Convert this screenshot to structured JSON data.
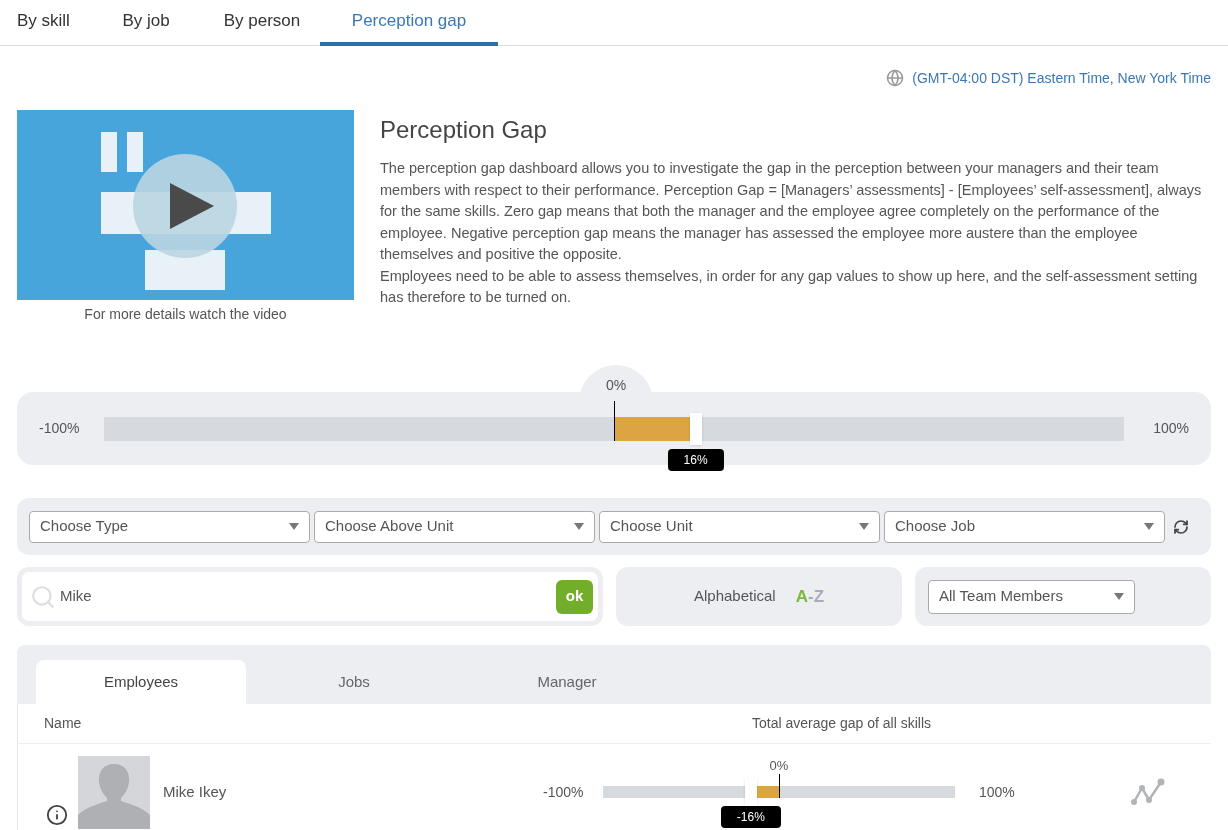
{
  "tabs": [
    {
      "label": "By skill",
      "selected": false
    },
    {
      "label": "By job",
      "selected": false
    },
    {
      "label": "By person",
      "selected": false
    },
    {
      "label": "Perception gap",
      "selected": true
    }
  ],
  "timezone": "(GMT-04:00 DST) Eastern Time, New York Time",
  "video": {
    "caption": "For more details watch the video"
  },
  "intro": {
    "title": "Perception Gap",
    "paragraphs": [
      "The perception gap dashboard allows you to investigate the gap in the perception between your managers and their team members with respect to their performance. Perception Gap = [Managers’ assessments] - [Employees’ self-assessment], always for the same skills. Zero gap means that both the manager and the employee agree completely on the performance of the employee. Negative perception gap means the manager has assessed the employee more austere than the employee themselves and positive the opposite.",
      "Employees need to be able to assess themselves, in order for any gap values to show up here, and the self-assessment setting has therefore to be turned on."
    ]
  },
  "gap_filter": {
    "min_label": "-100%",
    "max_label": "100%",
    "center_label": "0%",
    "level": 0.58,
    "reading": "16%"
  },
  "dropdowns": [
    {
      "placeholder": "Choose Type"
    },
    {
      "placeholder": "Choose Above Unit"
    },
    {
      "placeholder": "Choose Unit"
    },
    {
      "placeholder": "Choose Job"
    }
  ],
  "search": {
    "value": "Mike",
    "button": "ok"
  },
  "sort": {
    "label": "Alphabetical",
    "first": "A",
    "dash": "-",
    "last": "Z"
  },
  "members_filter": "All Team Members",
  "list_tabs": [
    {
      "label": "Employees",
      "selected": true
    },
    {
      "label": "Jobs",
      "selected": false
    },
    {
      "label": "Manager",
      "selected": false
    }
  ],
  "columns": [
    "Name",
    "Total average gap of all skills"
  ],
  "rows": [
    {
      "name": "Mike Ikey",
      "min_label": "-100%",
      "max_label": "100%",
      "center_label": "0%",
      "level": 0.42,
      "reading": "-16%"
    }
  ]
}
